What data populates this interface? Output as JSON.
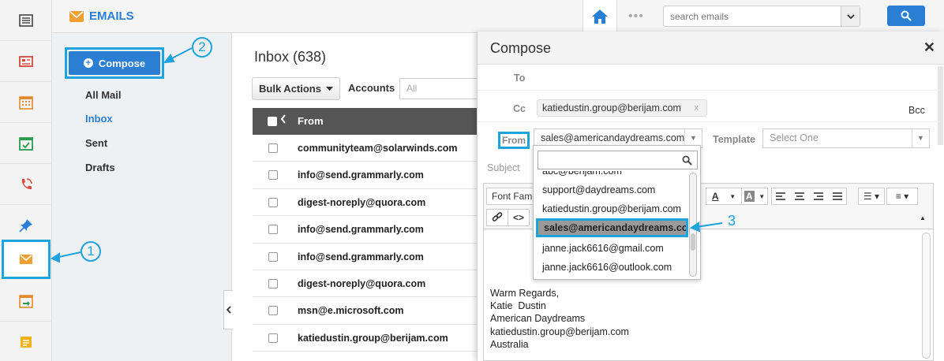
{
  "header": {
    "app_title": "EMAILS",
    "search_placeholder": "search emails",
    "dots": "•••"
  },
  "mailnav": {
    "compose_label": "Compose",
    "items": [
      {
        "label": "All Mail",
        "selected": false
      },
      {
        "label": "Inbox",
        "selected": true
      },
      {
        "label": "Sent",
        "selected": false
      },
      {
        "label": "Drafts",
        "selected": false
      }
    ]
  },
  "inbox": {
    "title": "Inbox (638)",
    "bulk_actions_label": "Bulk Actions",
    "accounts_label": "Accounts",
    "accounts_value": "All",
    "column_from": "From",
    "rows": [
      "communityteam@solarwinds.com",
      "info@send.grammarly.com",
      "digest-noreply@quora.com",
      "info@send.grammarly.com",
      "info@send.grammarly.com",
      "digest-noreply@quora.com",
      "msn@e.microsoft.com",
      "katiedustin.group@berijam.com"
    ]
  },
  "compose": {
    "title": "Compose",
    "to_label": "To",
    "cc_label": "Cc",
    "cc_chip": "katiedustin.group@berijam.com",
    "cc_chip_remove": "x",
    "bcc_label": "Bcc",
    "from_label": "From",
    "from_value": "sales@americandaydreams.com",
    "template_label": "Template",
    "template_value": "Select One",
    "subject_label": "Subject",
    "font_family_label": "Font Family",
    "signature": [
      "Warm Regards,",
      "Katie  Dustin",
      "American Daydreams",
      "katiedustin.group@berijam.com",
      "Australia"
    ],
    "from_options": [
      "abc@berijam.com",
      "support@daydreams.com",
      "katiedustin.group@berijam.com",
      "sales@americandaydreams.com",
      "janne.jack6616@gmail.com",
      "janne.jack6616@outlook.com"
    ],
    "from_selected_index": 3
  },
  "annotations": [
    "1",
    "2",
    "3"
  ],
  "colors": {
    "accent": "#2a7fd4",
    "annotation": "#1fa3dc",
    "table_header": "#555555"
  },
  "rail_icons": [
    "list-icon",
    "newspaper-icon",
    "calendar-grid-icon",
    "calendar-check-icon",
    "phone-icon",
    "pin-icon",
    "email-icon",
    "calendar-export-icon",
    "note-icon"
  ]
}
